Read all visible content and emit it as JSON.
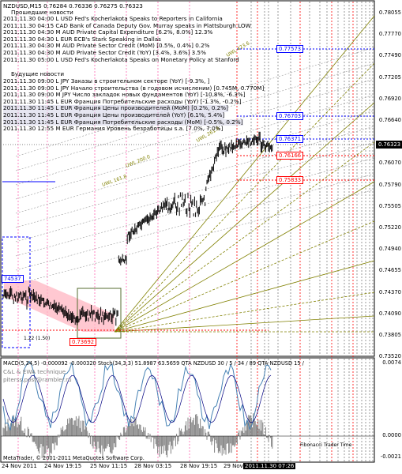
{
  "chart_header": "NZDUSD,M15  0.76284 0.76336 0.76275 0.76323",
  "news_past_title": "Прошедшие новости",
  "news_past": [
    "2011.11.30 04:00 L USD Fed's Kocherlakota Speaks to Reporters in California",
    "2011.11.30 04:15  CAD Bank of Canada Deputy Gov. Murray speaks in Plattsburgh  LOW",
    "2011.11.30 04:30 M AUD Private Capital Expenditure [6.2%, 8.0%] 12.3%",
    "2011.11.30 04:30 L EUR ECB's Stark Speaking in Dallas",
    "2011.11.30 04:30 M AUD Private Sector Credit (MoM) [0.5%, 0.4%] 0.2%",
    "2011.11.30 04:30 M AUD Private Sector Credit (YoY) [3.4%, 3.6%] 3.5%",
    "2011.11.30 05:00 L USD Fed's Kocherlakota Speaks on Monetary Policy at Stanford"
  ],
  "news_future_title": "Будущие новости",
  "news_future": [
    "2011.11.30 09:00 L JPY Заказы в строительном секторе (YoY) [-9.3%, ]",
    "2011.11.30 09:00 L JPY Начало строительства (в годовом исчислении) [0.745M, 0.770M]",
    "2011.11.30 09:00 M JPY Число закладок новых фундаментов (YoY) [-10.8%, -6.3%]",
    "2011.11.30 11:45 L EUR Франция Потребительские расходы (YoY) [-1.3%, -0.2%]",
    "2011.11.30 11:45 L EUR Франция Цены производителей (MoM) [0.2%, 0.2%]",
    "2011.11.30 11:45 L EUR Франция Цены производителей (YoY) [6.1%, 5.4%]",
    "2011.11.30 11:45 L EUR Франция Потребительские расходы (MoM) [-0.5%, 0.2%]",
    "2011.11.30 12:55 M EUR Германия Уровень безработицы s.a. [7.0%, 7.0%]"
  ],
  "price_axis": [
    "0.78055",
    "0.77770",
    "0.77490",
    "0.77205",
    "0.76920",
    "0.76640",
    "0.76323",
    "0.76070",
    "0.75790",
    "0.75505",
    "0.75220",
    "0.74940",
    "0.74655",
    "0.74370",
    "0.74090",
    "0.73805",
    "0.73520"
  ],
  "current_price": "0.76323",
  "level_tags": [
    "0.77573",
    "0.76703",
    "0.76371",
    "0.76166",
    "0.75833"
  ],
  "left_tags": {
    "box_price": "74537",
    "low_price": "0.73692",
    "ratio": "1.22 (1.50)"
  },
  "fib_labels": [
    "UWL 423.6",
    "UWL 261.8",
    "UWL 200.0",
    "UWL 161.8"
  ],
  "indicator_header": "MACD(5,34,5) -0.000092 -0.000320  Stoch(34,3,3) 51.8987 63.5659   QTA NZDUSD 30 / 5 / 34 / 89  QTA NZDUSD 15 /",
  "indicator_sub1": "C&L & EWA technique",
  "indicator_sub2": "piterss.post@rambler.ru",
  "indicator_axis": [
    "0.0074",
    "0.0000",
    "-0.0021"
  ],
  "time_axis": [
    "24 Nov 2011",
    "24 Nov 19:15",
    "25 Nov 11:15",
    "28 Nov 03:15",
    "28 Nov 19:15",
    "29 Nov 11",
    "2011.11.30 07:26"
  ],
  "copyright": "MetaTrader, © 2001-2011 MetaQuotes Software Corp.",
  "fib_time_label": "Fibonacci Trader Time",
  "colors": {
    "bull": "#0000ff",
    "bear": "#ff0000",
    "fib": "#808000",
    "candles": "#000000",
    "macd": "#808080",
    "stoch": "#4682b4"
  }
}
